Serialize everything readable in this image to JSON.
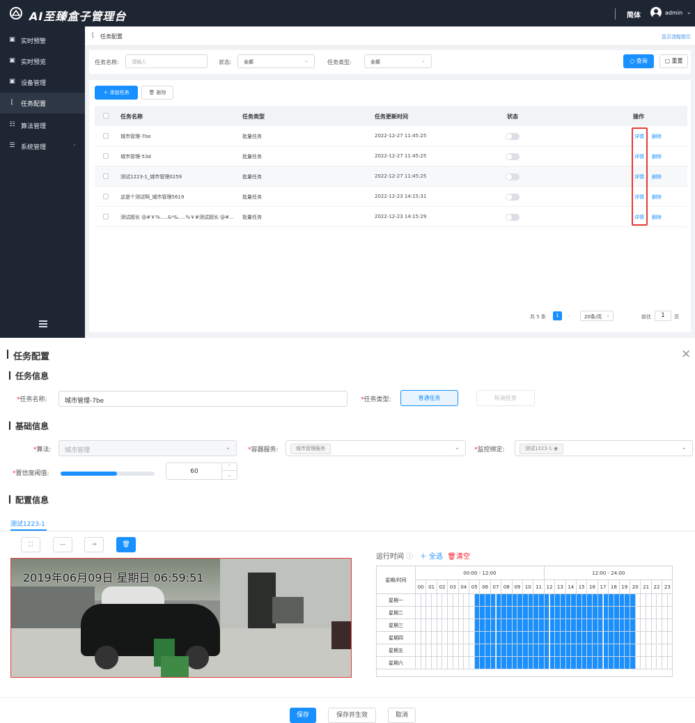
{
  "header": {
    "app_title": "AI至臻盒子管理台",
    "lang": "简体",
    "user": "admin"
  },
  "sidebar": {
    "items": [
      {
        "icon": "monitor-icon",
        "label": "实时预警"
      },
      {
        "icon": "preview-icon",
        "label": "实时预览"
      },
      {
        "icon": "device-icon",
        "label": "设备管理"
      },
      {
        "icon": "task-icon",
        "label": "任务配置",
        "active": true
      },
      {
        "icon": "algorithm-icon",
        "label": "算法管理"
      },
      {
        "icon": "settings-icon",
        "label": "系统管理"
      }
    ]
  },
  "breadcrumb": {
    "title": "任务配置",
    "help": "显示流程指引"
  },
  "filter": {
    "task_name_label": "任务名称:",
    "task_name_placeholder": "请输入",
    "status_label": "状态:",
    "status_value": "全部",
    "task_type_label": "任务类型:",
    "task_type_value": "全部",
    "query": "查询",
    "reset": "重置"
  },
  "toolbar": {
    "add": "添加任务",
    "delete": "删除"
  },
  "table": {
    "columns": [
      "任务名称",
      "任务类型",
      "任务更新时间",
      "状态",
      "操作"
    ],
    "rows": [
      {
        "name": "城市管理-7be",
        "type": "批量任务",
        "time": "2022-12-27 11:45:25",
        "detail": "详情",
        "delete": "删除"
      },
      {
        "name": "城市管理-53d",
        "type": "批量任务",
        "time": "2022-12-27 11:45:25",
        "detail": "详情",
        "delete": "删除"
      },
      {
        "name": "测试1223-1_城市管理0259",
        "type": "批量任务",
        "time": "2022-12-27 11:45:25",
        "detail": "详情",
        "delete": "删除"
      },
      {
        "name": "这是个测试啊_城市管理5619",
        "type": "批量任务",
        "time": "2022-12-23 14:15:31",
        "detail": "详情",
        "delete": "删除"
      },
      {
        "name": "测试超长 @#￥%.....&*&.....%￥#测试超长 @#...",
        "type": "批量任务",
        "time": "2022-12-23 14:15:29",
        "detail": "详情",
        "delete": "删除"
      }
    ]
  },
  "pagination": {
    "total": "共 5 条",
    "current": "1",
    "page_size": "20条/页",
    "goto_label": "前往",
    "goto_value": "1",
    "page_unit": "页"
  },
  "dialog": {
    "title": "任务配置",
    "section_task_info": "任务信息",
    "task_name_label": "任务名称:",
    "task_name_value": "城市管理-7be",
    "task_type_label": "任务类型:",
    "task_type_normal": "普通任务",
    "task_type_polling": "轮询任务",
    "section_basic": "基础信息",
    "algorithm_label": "算法:",
    "algorithm_value": "城市管理",
    "container_label": "容器服务:",
    "container_value": "城市管理服务",
    "monitor_label": "监控绑定:",
    "monitor_value": "测试1223-1",
    "confidence_label": "置信度阈值:",
    "confidence_value": 60,
    "section_config": "配置信息",
    "camera_tab": "测试1223-1",
    "osd_text": "2019年06月09日  星期日  06:59:51",
    "schedule": {
      "label": "运行时间",
      "select_all": "全选",
      "clear": "清空",
      "corner": "星期/时间",
      "ranges": [
        "00:00 - 12:00",
        "12:00 - 24:00"
      ],
      "hours": [
        "00",
        "01",
        "02",
        "03",
        "04",
        "05",
        "06",
        "07",
        "08",
        "09",
        "10",
        "11",
        "12",
        "13",
        "14",
        "15",
        "16",
        "17",
        "18",
        "19",
        "20",
        "21",
        "22",
        "23"
      ],
      "days": [
        "星期一",
        "星期二",
        "星期三",
        "星期四",
        "星期五",
        "星期六"
      ],
      "active_half_hours_start": 11,
      "active_half_hours_end": 40
    },
    "buttons": {
      "save": "保存",
      "save_apply": "保存并生效",
      "cancel": "取消"
    }
  },
  "colors": {
    "accent": "#1890ff",
    "sidebar_bg": "#1f2633",
    "highlight": "#e53935"
  }
}
